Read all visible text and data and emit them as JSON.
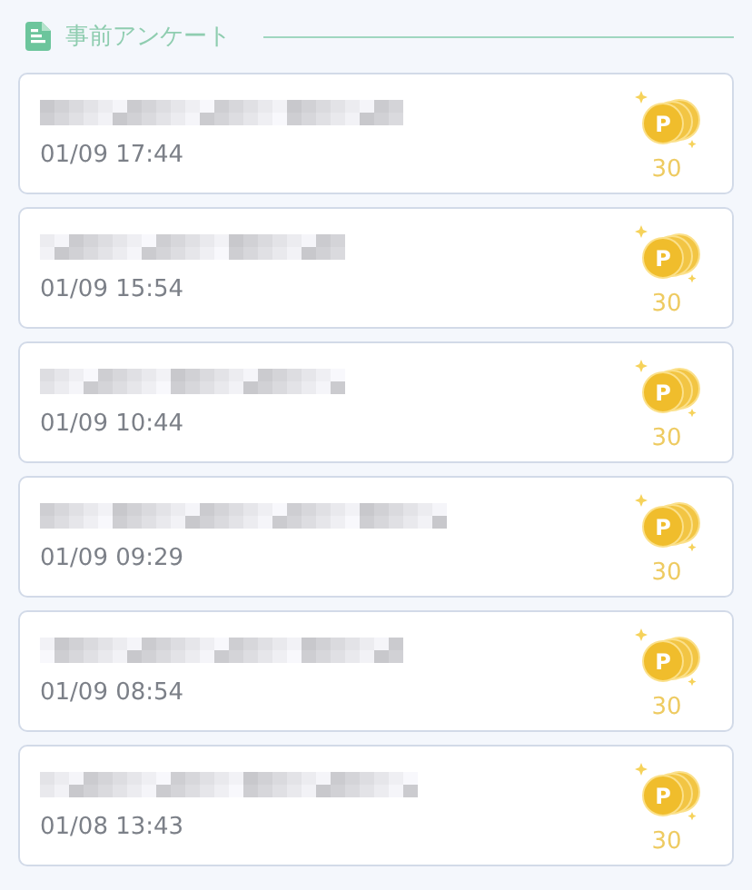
{
  "section": {
    "title": "事前アンケート"
  },
  "surveys": [
    {
      "date": "01/09 17:44",
      "coin_letter": "P",
      "points": "30"
    },
    {
      "date": "01/09 15:54",
      "coin_letter": "P",
      "points": "30"
    },
    {
      "date": "01/09 10:44",
      "coin_letter": "P",
      "points": "30"
    },
    {
      "date": "01/09 09:29",
      "coin_letter": "P",
      "points": "30"
    },
    {
      "date": "01/09 08:54",
      "coin_letter": "P",
      "points": "30"
    },
    {
      "date": "01/08 13:43",
      "coin_letter": "P",
      "points": "30"
    }
  ]
}
